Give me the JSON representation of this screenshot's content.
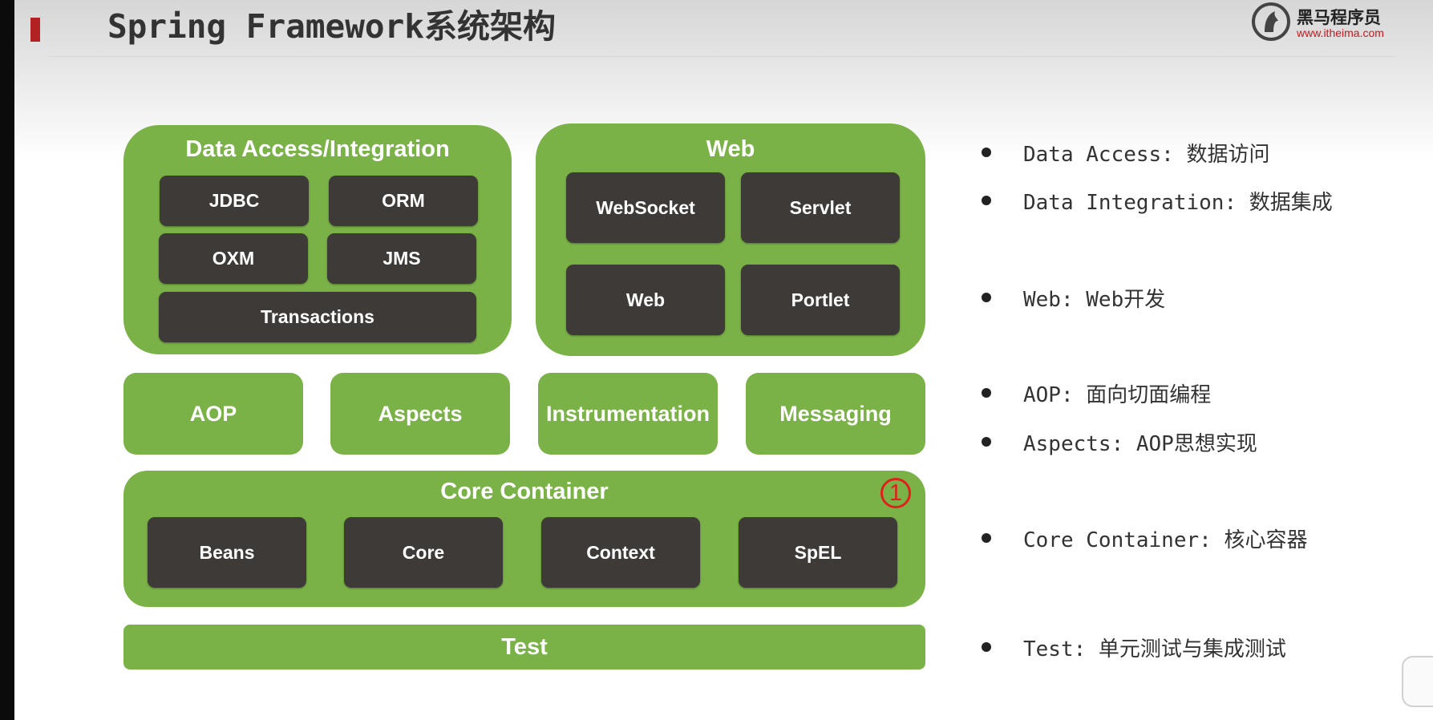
{
  "header": {
    "title": "Spring Framework系统架构",
    "logo_name": "黑马程序员",
    "logo_url": "www.itheima.com"
  },
  "diagram": {
    "data_access": {
      "title": "Data Access/Integration",
      "items": [
        "JDBC",
        "ORM",
        "OXM",
        "JMS",
        "Transactions"
      ]
    },
    "web": {
      "title": "Web",
      "items": [
        "WebSocket",
        "Servlet",
        "Web",
        "Portlet"
      ]
    },
    "middle": [
      "AOP",
      "Aspects",
      "Instrumentation",
      "Messaging"
    ],
    "core_container": {
      "title": "Core Container",
      "marker": "1",
      "items": [
        "Beans",
        "Core",
        "Context",
        "SpEL"
      ]
    },
    "test": "Test"
  },
  "notes": [
    "Data Access: 数据访问",
    "Data Integration: 数据集成",
    "Web: Web开发",
    "AOP: 面向切面编程",
    "Aspects: AOP思想实现",
    "Core Container: 核心容器",
    "Test: 单元测试与集成测试"
  ],
  "colors": {
    "green": "#7ab247",
    "dark_tile": "#3e3a38",
    "accent_red": "#b22222",
    "marker_red": "#e0201b"
  }
}
